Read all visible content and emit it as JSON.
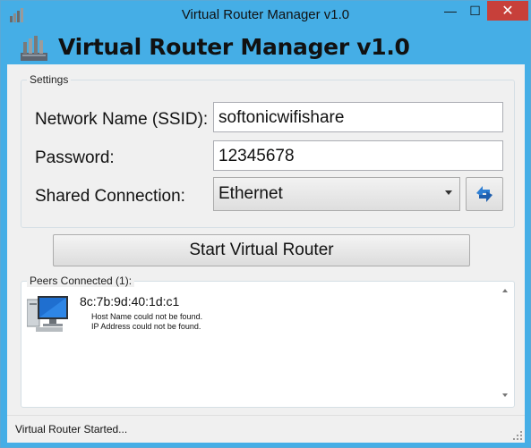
{
  "window": {
    "title": "Virtual Router Manager v1.0",
    "close_glyph": "✕",
    "minimize_glyph": "—",
    "maximize_glyph": "☐"
  },
  "header": {
    "title": "Virtual Router Manager v1.0",
    "logo_icon": "router-antenna-icon"
  },
  "settings": {
    "group_label": "Settings",
    "ssid_label": "Network Name (SSID):",
    "ssid_value": "softonicwifishare",
    "password_label": "Password:",
    "password_value": "12345678",
    "shared_label": "Shared Connection:",
    "shared_value": "Ethernet",
    "refresh_icon": "refresh-icon"
  },
  "actions": {
    "start_label": "Start Virtual Router"
  },
  "peers": {
    "group_label": "Peers Connected (1):",
    "items": [
      {
        "mac": "8c:7b:9d:40:1d:c1",
        "host_line": "Host Name could not be found.",
        "ip_line": "IP Address could not be found.",
        "icon": "computer-icon"
      }
    ]
  },
  "status": {
    "text": "Virtual Router Started..."
  },
  "colors": {
    "frame": "#45aee6",
    "close_button": "#c7403a",
    "client_bg": "#f0f0f0"
  }
}
